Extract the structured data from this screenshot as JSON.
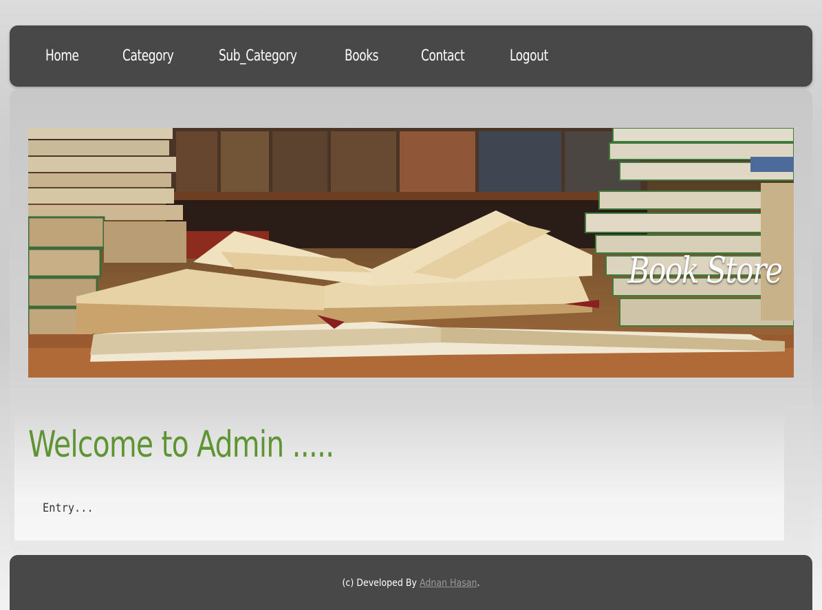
{
  "nav": {
    "items": [
      {
        "label": "Home"
      },
      {
        "label": "Category"
      },
      {
        "label": "Sub_Category"
      },
      {
        "label": "Books"
      },
      {
        "label": "Contact"
      },
      {
        "label": "Logout"
      }
    ]
  },
  "banner": {
    "title": "Book Store"
  },
  "main": {
    "heading": "Welcome to Admin .....",
    "body": "Entry..."
  },
  "footer": {
    "prefix": "(c) Developed By ",
    "author_link": "Adnan Hasan",
    "suffix": "."
  },
  "colors": {
    "nav_bg": "#484848",
    "heading": "#5e9432",
    "footer_link": "#9a9a9a"
  }
}
